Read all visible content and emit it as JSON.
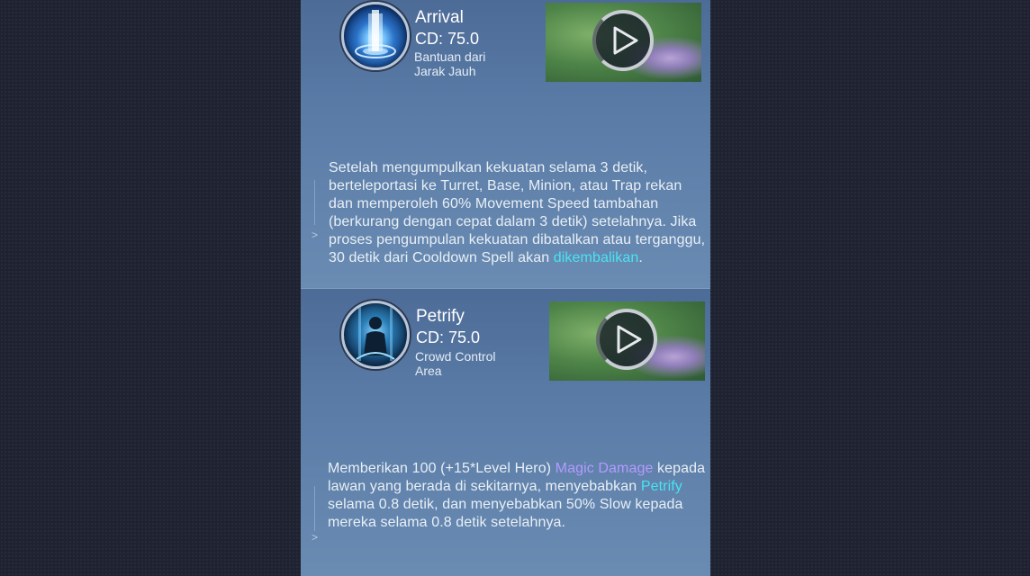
{
  "skills": [
    {
      "name": "Arrival",
      "cd": "CD: 75.0",
      "category_line1": "Bantuan dari",
      "category_line2": "Jarak Jauh",
      "desc_part1": "Setelah mengumpulkan kekuatan selama 3 detik, berteleportasi ke Turret, Base, Minion, atau Trap rekan dan memperoleh 60% Movement Speed tambahan (berkurang dengan cepat dalam 3 detik) setelahnya. Jika proses pengumpulan kekuatan dibatalkan atau terganggu, 30 detik dari Cooldown Spell akan ",
      "desc_hl1": "dikembalikan",
      "desc_part2": "."
    },
    {
      "name": "Petrify",
      "cd": "CD: 75.0",
      "category_line1": "Crowd Control",
      "category_line2": "Area",
      "desc_part1": "Memberikan 100 (+15*Level Hero) ",
      "desc_hl1": "Magic Damage",
      "desc_part2": " kepada lawan yang berada di sekitarnya, menyebabkan ",
      "desc_hl2": "Petrify",
      "desc_part3": " selama 0.8 detik, dan menyebabkan 50% Slow kepada mereka selama 0.8 detik setelahnya."
    }
  ],
  "colors": {
    "highlight_cyan": "#49e3f2",
    "highlight_purple": "#b59aff",
    "panel_blue": "#587aa5"
  },
  "icons": {
    "arrival": "arrival-spell-icon",
    "petrify": "petrify-spell-icon",
    "play": "play-icon"
  }
}
